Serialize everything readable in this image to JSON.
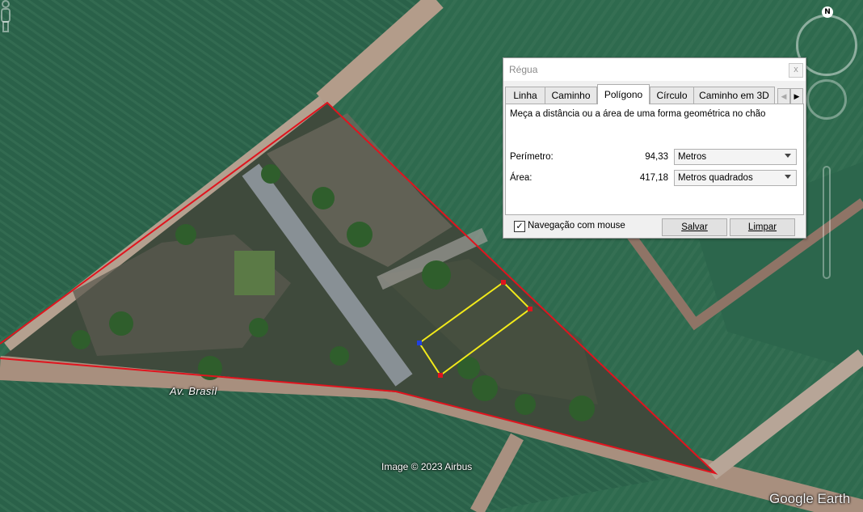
{
  "map": {
    "street_label": "Av. Brasil",
    "credit": "Image © 2023 Airbus",
    "brand": "Google Earth",
    "north_label": "N",
    "colors": {
      "boundary": "#e0141e",
      "measure": "#f2ea1a",
      "field": "#2f6c4f",
      "road": "#b8a18f"
    }
  },
  "dialog": {
    "title": "Régua",
    "close_label": "x",
    "tabs": [
      {
        "label": "Linha",
        "active": false
      },
      {
        "label": "Caminho",
        "active": false
      },
      {
        "label": "Polígono",
        "active": true
      },
      {
        "label": "Círculo",
        "active": false
      },
      {
        "label": "Caminho em 3D",
        "active": false
      }
    ],
    "description": "Meça a distância ou a área de uma forma geométrica no chão",
    "perimeter": {
      "label": "Perímetro:",
      "value": "94,33",
      "unit": "Metros"
    },
    "area": {
      "label": "Área:",
      "value": "417,18",
      "unit": "Metros quadrados"
    },
    "mouse_nav": {
      "label": "Navegação com mouse",
      "checked": true
    },
    "save_label": "Salvar",
    "clear_label": "Limpar"
  }
}
